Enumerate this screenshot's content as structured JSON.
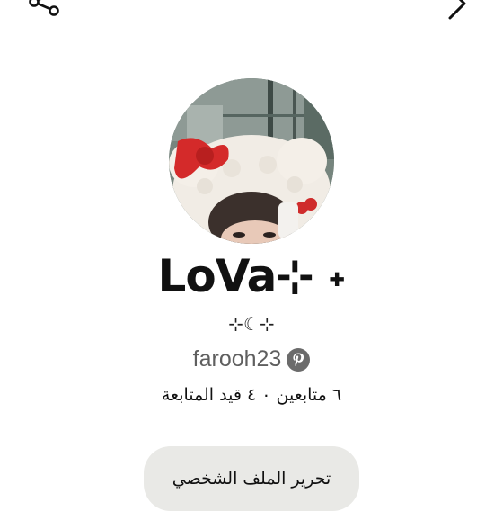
{
  "header": {
    "share_icon": "share-icon",
    "back_icon": "chevron-right-icon"
  },
  "profile": {
    "avatar": "avatar-photo",
    "display_name": "LoVa⊹ ˖",
    "bio": "⊹☾⊹",
    "username": "farooh23",
    "platform_icon": "pinterest-icon",
    "platform_color": "#6b6b6b",
    "stats": "٦ متابعين ٠ ٤ قيد المتابعة"
  },
  "actions": {
    "edit_profile_label": "تحرير الملف الشخصي",
    "edit_button_bg": "#e9e9e6"
  }
}
